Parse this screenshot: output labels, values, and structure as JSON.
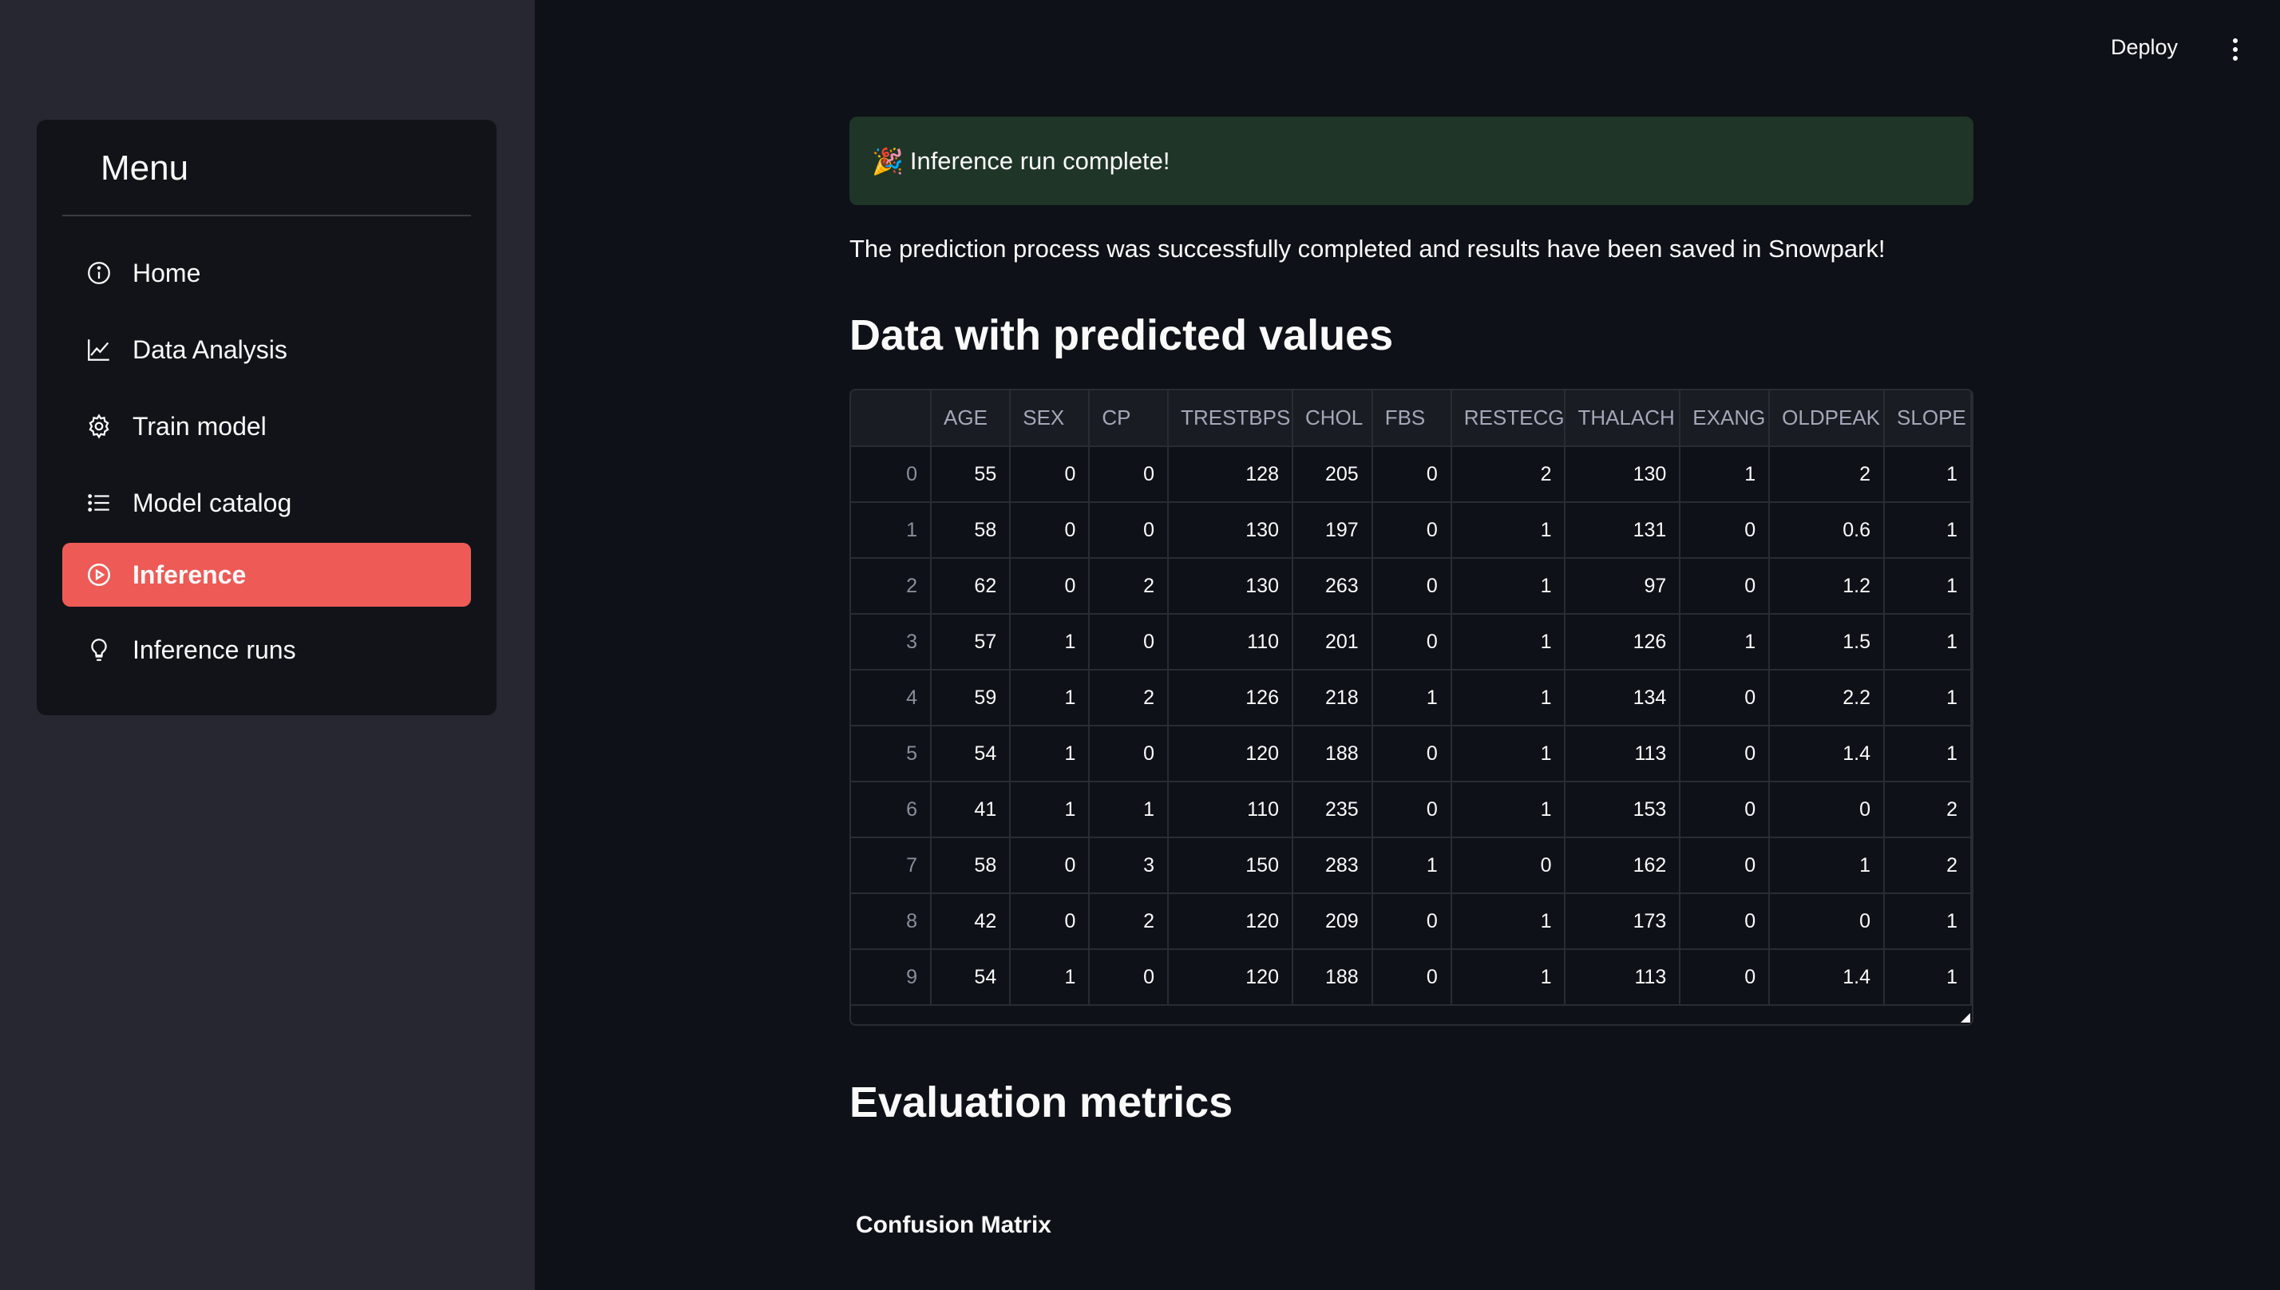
{
  "topbar": {
    "deploy_label": "Deploy",
    "menu_icon": "kebab-icon"
  },
  "sidebar": {
    "title": "Menu",
    "items": [
      {
        "label": "Home",
        "icon": "info-icon",
        "active": false
      },
      {
        "label": "Data Analysis",
        "icon": "chart-line-icon",
        "active": false
      },
      {
        "label": "Train model",
        "icon": "gear-icon",
        "active": false
      },
      {
        "label": "Model catalog",
        "icon": "list-icon",
        "active": false
      },
      {
        "label": "Inference",
        "icon": "play-circle-icon",
        "active": true
      },
      {
        "label": "Inference runs",
        "icon": "lightbulb-icon",
        "active": false
      }
    ],
    "active_color": "#ee5a56"
  },
  "main": {
    "alert": {
      "emoji": "🎉",
      "text": "Inference run complete!",
      "color": "#1f3527"
    },
    "description": "The prediction process was successfully completed and results have been saved in Snowpark!",
    "section_title": "Data with predicted values",
    "table": {
      "columns": [
        "",
        "AGE",
        "SEX",
        "CP",
        "TRESTBPS",
        "CHOL",
        "FBS",
        "RESTECG",
        "THALACH",
        "EXANG",
        "OLDPEAK",
        "SLOPE"
      ],
      "rows": [
        [
          "0",
          "55",
          "0",
          "0",
          "128",
          "205",
          "0",
          "2",
          "130",
          "1",
          "2",
          "1"
        ],
        [
          "1",
          "58",
          "0",
          "0",
          "130",
          "197",
          "0",
          "1",
          "131",
          "0",
          "0.6",
          "1"
        ],
        [
          "2",
          "62",
          "0",
          "2",
          "130",
          "263",
          "0",
          "1",
          "97",
          "0",
          "1.2",
          "1"
        ],
        [
          "3",
          "57",
          "1",
          "0",
          "110",
          "201",
          "0",
          "1",
          "126",
          "1",
          "1.5",
          "1"
        ],
        [
          "4",
          "59",
          "1",
          "2",
          "126",
          "218",
          "1",
          "1",
          "134",
          "0",
          "2.2",
          "1"
        ],
        [
          "5",
          "54",
          "1",
          "0",
          "120",
          "188",
          "0",
          "1",
          "113",
          "0",
          "1.4",
          "1"
        ],
        [
          "6",
          "41",
          "1",
          "1",
          "110",
          "235",
          "0",
          "1",
          "153",
          "0",
          "0",
          "2"
        ],
        [
          "7",
          "58",
          "0",
          "3",
          "150",
          "283",
          "1",
          "0",
          "162",
          "0",
          "1",
          "2"
        ],
        [
          "8",
          "42",
          "0",
          "2",
          "120",
          "209",
          "0",
          "1",
          "173",
          "0",
          "0",
          "1"
        ],
        [
          "9",
          "54",
          "1",
          "0",
          "120",
          "188",
          "0",
          "1",
          "113",
          "0",
          "1.4",
          "1"
        ]
      ]
    },
    "metrics_title": "Evaluation metrics",
    "confusion_title": "Confusion Matrix"
  }
}
